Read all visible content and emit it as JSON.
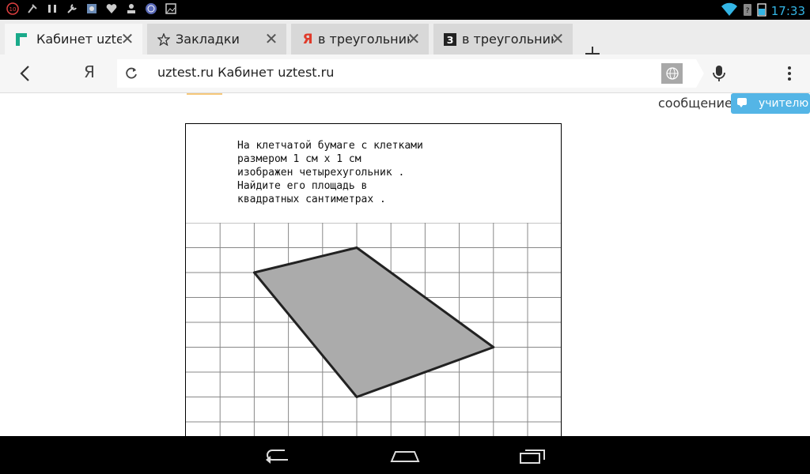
{
  "status_bar": {
    "time": "17:33",
    "notification_icons": [
      "badge-10-icon",
      "clean-icon",
      "pause-icon",
      "wrench-icon",
      "photo-app-icon",
      "heart-icon",
      "download-icon",
      "circle-b-icon",
      "image-icon"
    ],
    "status_icons": [
      "wifi-icon",
      "signal-icon",
      "battery-icon"
    ]
  },
  "tabs": [
    {
      "title": "Кабинет uztes",
      "icon": "site-favicon-icon",
      "active": true
    },
    {
      "title": "Закладки",
      "icon": "star-icon",
      "active": false
    },
    {
      "title": "в треугольник",
      "icon": "yandex-favicon-icon",
      "active": false
    },
    {
      "title": "в треугольник",
      "icon": "z-favicon-icon",
      "active": false
    }
  ],
  "toolbar": {
    "yandex_label": "Я",
    "url": "uztest.ru Кабинет uztest.ru"
  },
  "page": {
    "message_label": "сообщение",
    "teacher_button": "учителю",
    "problem_text": "На клетчатой бумаге с клетками\nразмером 1 см x 1 см\nизображен четырехугольник .\nНайдите его площадь в\nквадратных сантиметрах .",
    "quadrilateral_vertices": [
      [
        2,
        2
      ],
      [
        5,
        1
      ],
      [
        9,
        5
      ],
      [
        5,
        7
      ]
    ],
    "colors": {
      "accent": "#54b5e6",
      "shape_fill": "#ababab",
      "clock": "#33b5e5"
    }
  },
  "nav_bar": {
    "buttons": [
      "back-nav-icon",
      "home-nav-icon",
      "recents-nav-icon"
    ]
  }
}
